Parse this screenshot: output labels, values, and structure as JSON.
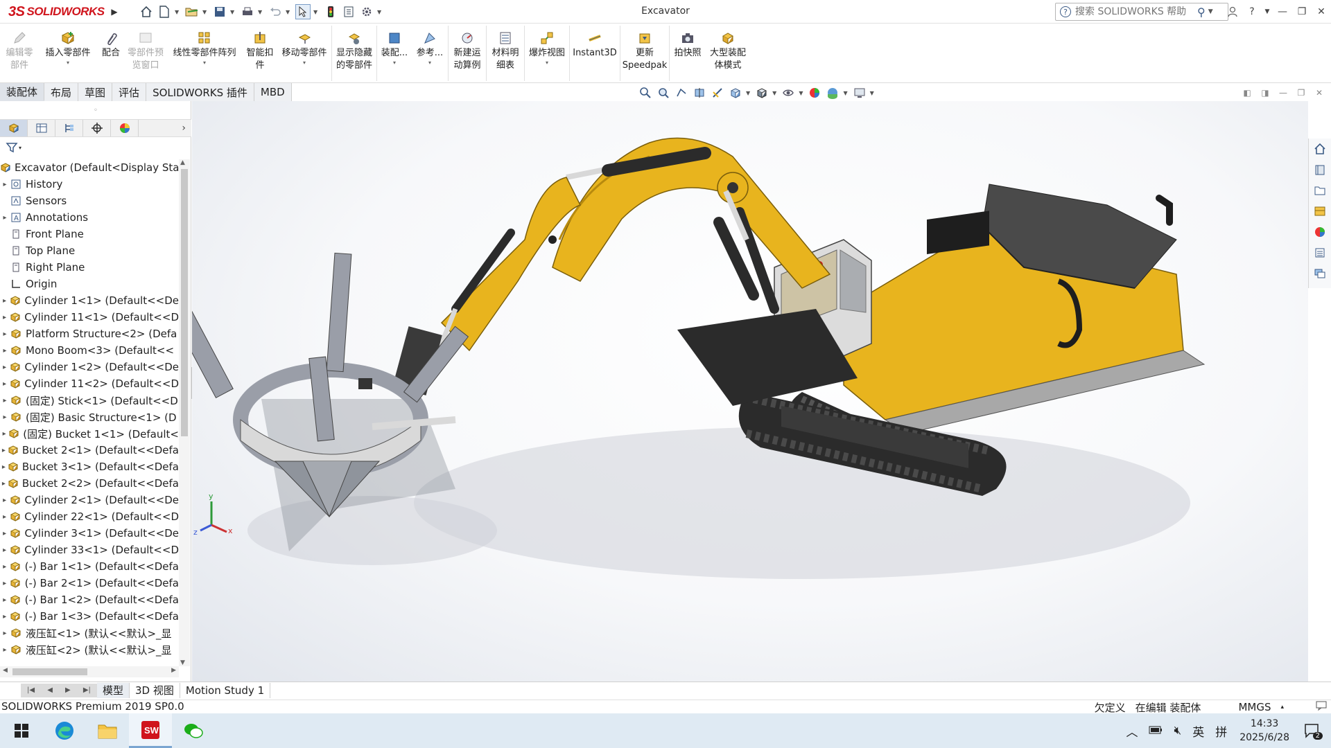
{
  "window": {
    "title": "Excavator"
  },
  "app": {
    "logo_text": "SOLIDWORKS",
    "logo_mark": "3S"
  },
  "search": {
    "placeholder": "搜索 SOLIDWORKS 帮助"
  },
  "command_manager": {
    "items": [
      {
        "label_1": "编辑零",
        "label_2": "部件",
        "disabled": true
      },
      {
        "label_1": "插入零部件",
        "label_2": ""
      },
      {
        "label_1": "配合",
        "label_2": ""
      },
      {
        "label_1": "零部件预",
        "label_2": "览窗口",
        "disabled": true
      },
      {
        "label_1": "线性零部件阵列",
        "label_2": ""
      },
      {
        "label_1": "智能扣",
        "label_2": "件"
      },
      {
        "label_1": "移动零部件",
        "label_2": ""
      },
      {
        "label_1": "显示隐藏",
        "label_2": "的零部件"
      },
      {
        "label_1": "装配...",
        "label_2": ""
      },
      {
        "label_1": "参考...",
        "label_2": ""
      },
      {
        "label_1": "新建运",
        "label_2": "动算例"
      },
      {
        "label_1": "材料明",
        "label_2": "细表"
      },
      {
        "label_1": "爆炸视图",
        "label_2": ""
      },
      {
        "label_1": "Instant3D",
        "label_2": ""
      },
      {
        "label_1": "更新",
        "label_2": "Speedpak"
      },
      {
        "label_1": "拍快照",
        "label_2": ""
      },
      {
        "label_1": "大型装配",
        "label_2": "体模式"
      }
    ]
  },
  "tabs": [
    "装配体",
    "布局",
    "草图",
    "评估",
    "SOLIDWORKS 插件",
    "MBD"
  ],
  "feature_tree": {
    "root": "Excavator  (Default<Display Sta",
    "items": [
      {
        "label": "History",
        "icon": "history-folder-icon",
        "expandable": true
      },
      {
        "label": "Sensors",
        "icon": "sensors-icon",
        "expandable": false
      },
      {
        "label": "Annotations",
        "icon": "annotations-icon",
        "expandable": true
      },
      {
        "label": "Front Plane",
        "icon": "plane-icon",
        "expandable": false
      },
      {
        "label": "Top Plane",
        "icon": "plane-icon",
        "expandable": false
      },
      {
        "label": "Right Plane",
        "icon": "plane-icon",
        "expandable": false
      },
      {
        "label": "Origin",
        "icon": "origin-icon",
        "expandable": false
      },
      {
        "label": "Cylinder 1<1> (Default<<De",
        "icon": "component-icon",
        "expandable": true
      },
      {
        "label": "Cylinder 11<1> (Default<<D",
        "icon": "component-icon",
        "expandable": true
      },
      {
        "label": "Platform Structure<2> (Defa",
        "icon": "component-icon",
        "expandable": true
      },
      {
        "label": "Mono Boom<3> (Default<<",
        "icon": "component-icon",
        "expandable": true
      },
      {
        "label": "Cylinder 1<2> (Default<<De",
        "icon": "component-icon",
        "expandable": true
      },
      {
        "label": "Cylinder 11<2> (Default<<D",
        "icon": "component-icon",
        "expandable": true
      },
      {
        "label": "(固定) Stick<1> (Default<<D",
        "icon": "component-icon",
        "expandable": true
      },
      {
        "label": "(固定) Basic Structure<1> (D",
        "icon": "component-icon",
        "expandable": true
      },
      {
        "label": "(固定) Bucket 1<1> (Default<",
        "icon": "component-icon",
        "expandable": true
      },
      {
        "label": "Bucket 2<1> (Default<<Defa",
        "icon": "component-icon",
        "expandable": true
      },
      {
        "label": "Bucket 3<1> (Default<<Defa",
        "icon": "component-icon",
        "expandable": true
      },
      {
        "label": "Bucket 2<2> (Default<<Defa",
        "icon": "component-icon",
        "expandable": true
      },
      {
        "label": "Cylinder 2<1> (Default<<De",
        "icon": "component-icon",
        "expandable": true
      },
      {
        "label": "Cylinder 22<1> (Default<<D",
        "icon": "component-icon",
        "expandable": true
      },
      {
        "label": "Cylinder 3<1> (Default<<De",
        "icon": "component-icon",
        "expandable": true
      },
      {
        "label": "Cylinder 33<1> (Default<<D",
        "icon": "component-icon",
        "expandable": true
      },
      {
        "label": "(-) Bar 1<1> (Default<<Defa",
        "icon": "component-icon",
        "expandable": true
      },
      {
        "label": "(-) Bar 2<1> (Default<<Defa",
        "icon": "component-icon",
        "expandable": true
      },
      {
        "label": "(-) Bar 1<2> (Default<<Defa",
        "icon": "component-icon",
        "expandable": true
      },
      {
        "label": "(-) Bar 1<3> (Default<<Defa",
        "icon": "component-icon",
        "expandable": true
      },
      {
        "label": "液压缸<1> (默认<<默认>_显",
        "icon": "component-icon",
        "expandable": true
      },
      {
        "label": "液压缸<2> (默认<<默认>_显",
        "icon": "component-icon",
        "expandable": true
      }
    ]
  },
  "triad": {
    "x": "x",
    "y": "y",
    "z": "z"
  },
  "bottom_tabs": [
    "模型",
    "3D 视图",
    "Motion Study 1"
  ],
  "status": {
    "product": "SOLIDWORKS Premium 2019 SP0.0",
    "definition": "欠定义",
    "mode": "在编辑 装配体",
    "units": "MMGS"
  },
  "taskbar": {
    "time": "14:33",
    "date": "2025/6/28",
    "ime_lang": "英",
    "ime_mode": "拼",
    "notifications": "2"
  },
  "colors": {
    "brand_red": "#d0141c",
    "boom_yellow": "#e8b41e",
    "track_dark": "#2b2b2b",
    "bucket_gray": "#9a9ea8"
  }
}
